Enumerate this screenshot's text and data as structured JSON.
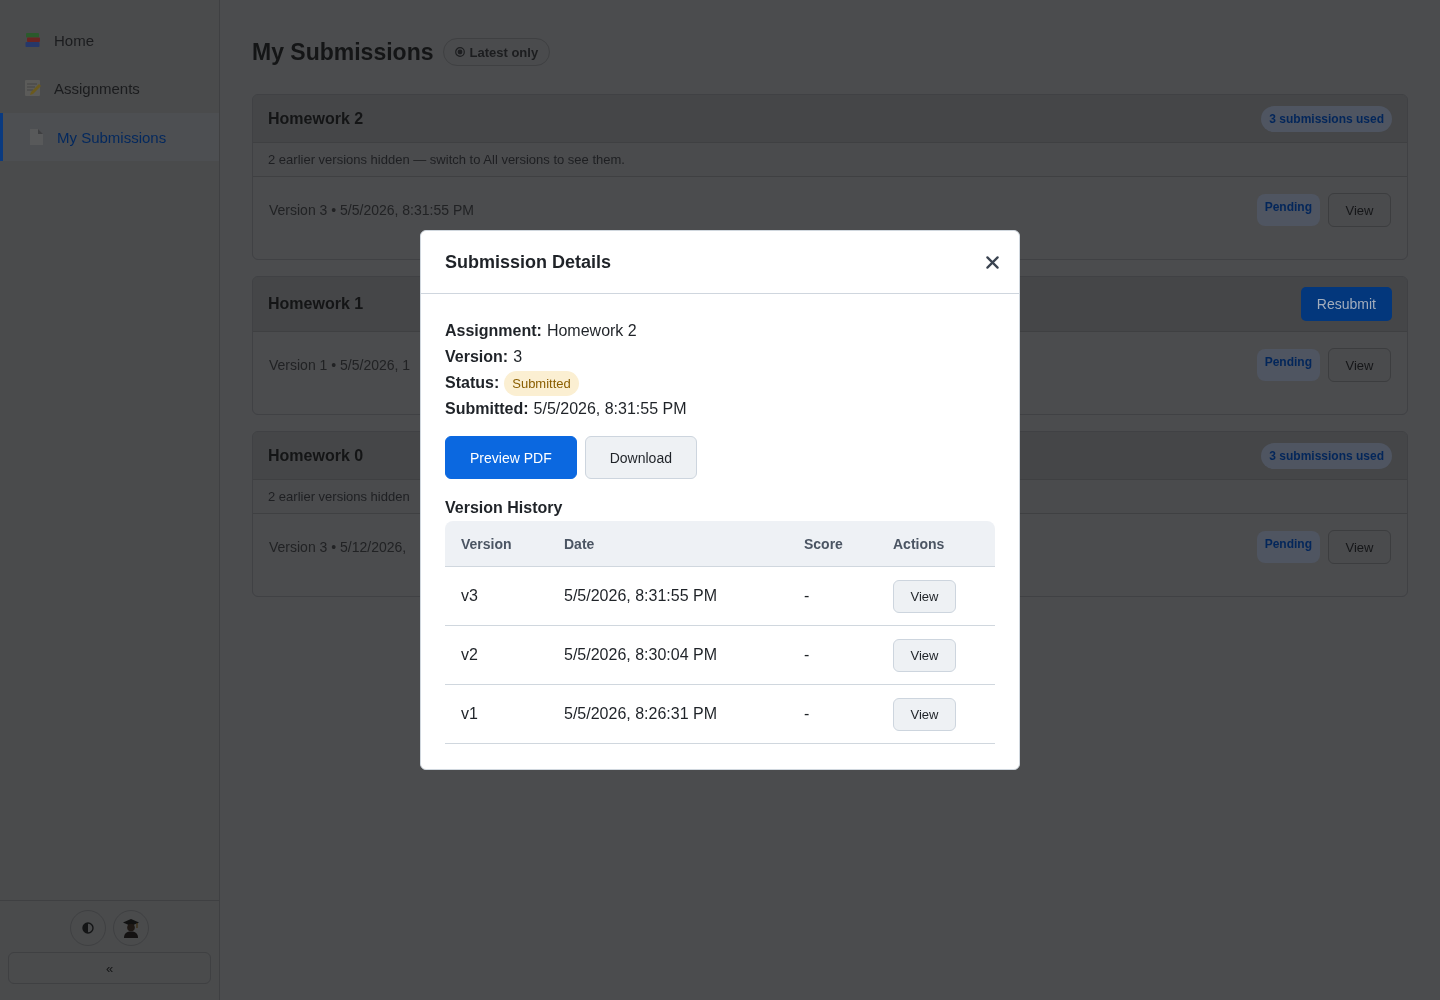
{
  "sidebar": {
    "items": [
      {
        "label": "Home",
        "selected": false
      },
      {
        "label": "Assignments",
        "selected": false
      },
      {
        "label": "My Submissions",
        "selected": true
      }
    ],
    "collapse_label": "«"
  },
  "page": {
    "title": "My Submissions",
    "filter": {
      "label": "Latest only"
    }
  },
  "submissions": [
    {
      "assignment": "Homework 2",
      "header_action": {
        "kind": "badge",
        "label": "3 submissions used"
      },
      "note": "2 earlier versions hidden — switch to All versions to see them.",
      "versions": [
        {
          "label": "Version 3 • 5/5/2026, 8:31:55 PM",
          "status": "Pending",
          "action": "View"
        }
      ]
    },
    {
      "assignment": "Homework 1",
      "header_action": {
        "kind": "button",
        "label": "Resubmit"
      },
      "versions": [
        {
          "label": "Version 1 • 5/5/2026, 1",
          "status": "Pending",
          "action": "View"
        }
      ]
    },
    {
      "assignment": "Homework 0",
      "header_action": {
        "kind": "badge",
        "label": "3 submissions used"
      },
      "note": "2 earlier versions hidden",
      "versions": [
        {
          "label": "Version 3 • 5/12/2026,",
          "status": "Pending",
          "action": "View"
        }
      ]
    }
  ],
  "modal": {
    "title": "Submission Details",
    "fields": [
      {
        "label": "Assignment:",
        "value": "Homework 2",
        "kind": "text"
      },
      {
        "label": "Version:",
        "value": "3",
        "kind": "text"
      },
      {
        "label": "Status:",
        "value": "Submitted",
        "kind": "badge"
      },
      {
        "label": "Submitted:",
        "value": "5/5/2026, 8:31:55 PM",
        "kind": "text"
      }
    ],
    "buttons": [
      {
        "label": "Preview PDF",
        "kind": "primary"
      },
      {
        "label": "Download",
        "kind": "secondary"
      }
    ],
    "history": {
      "title": "Version History",
      "columns": [
        "Version",
        "Date",
        "Score",
        "Actions"
      ],
      "rows": [
        {
          "version": "v3",
          "date": "5/5/2026, 8:31:55 PM",
          "score": "-",
          "action": "View"
        },
        {
          "version": "v2",
          "date": "5/5/2026, 8:30:04 PM",
          "score": "-",
          "action": "View"
        },
        {
          "version": "v1",
          "date": "5/5/2026, 8:26:31 PM",
          "score": "-",
          "action": "View"
        }
      ]
    }
  }
}
